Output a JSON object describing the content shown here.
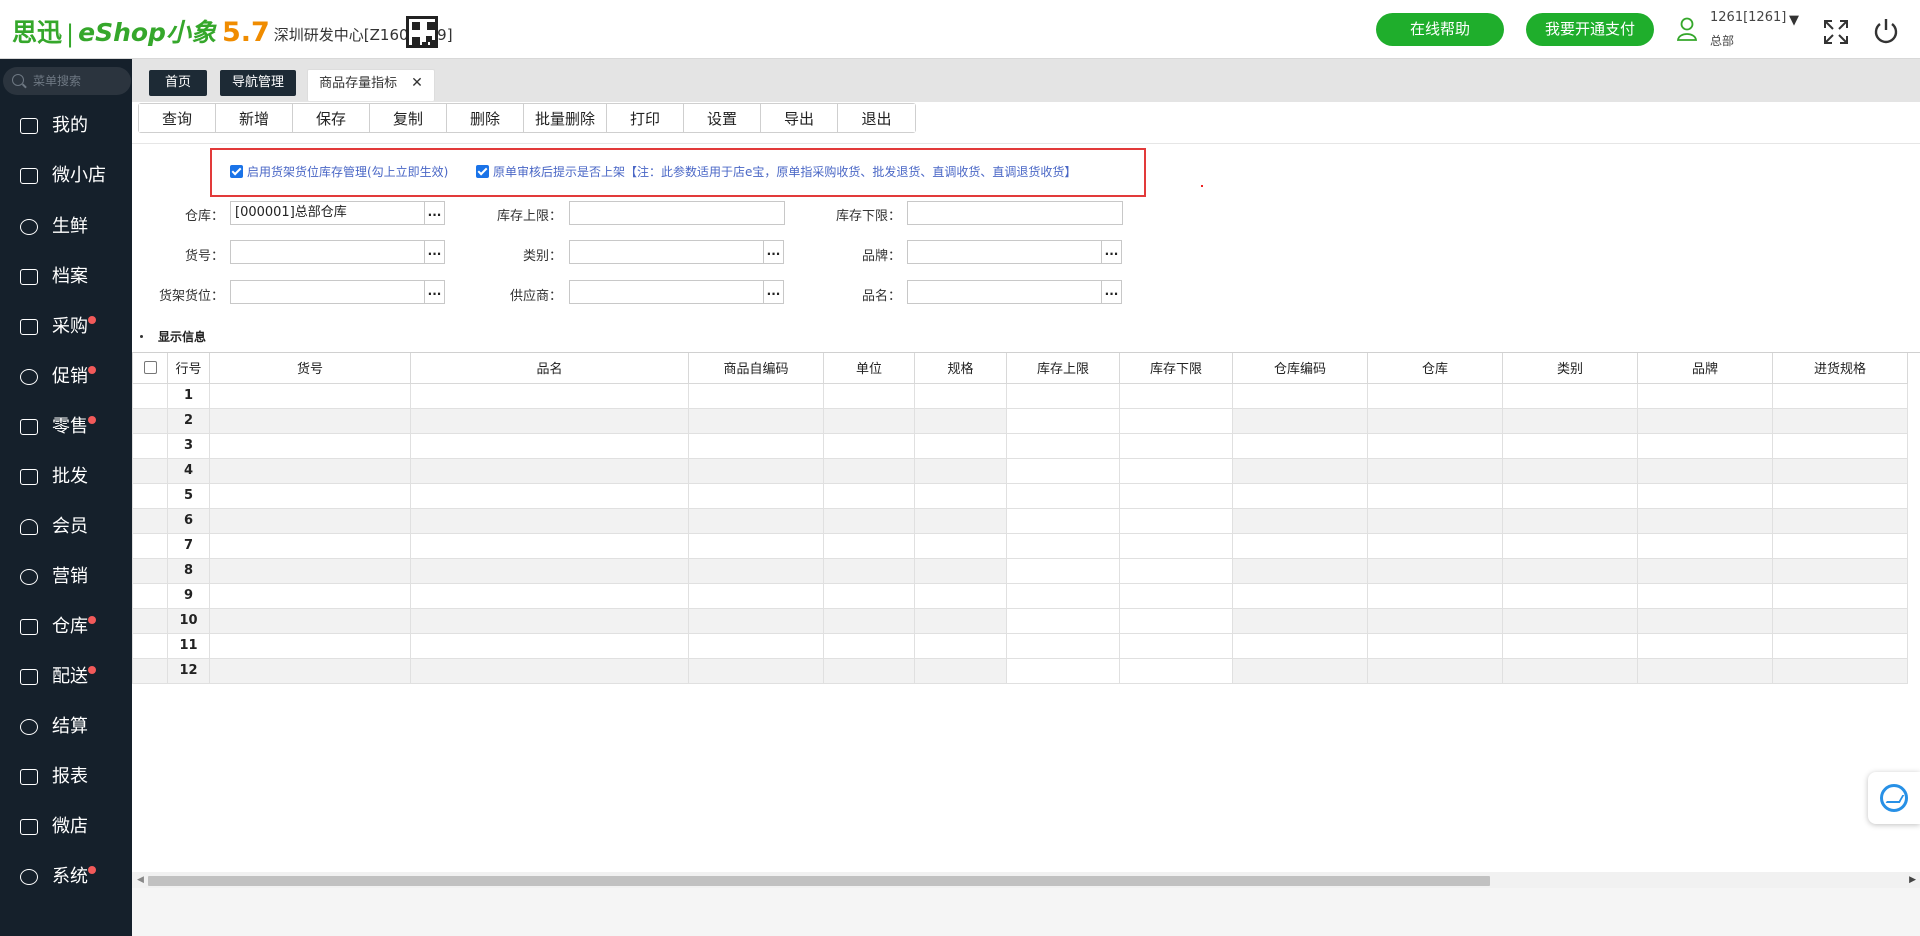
{
  "header": {
    "brand_cn": "思迅",
    "brand_sep": "|",
    "brand_name": "eShop小象",
    "version": "5.7",
    "org": "深圳研发中心[Z1600009]",
    "help_label": "在线帮助",
    "pay_label": "我要开通支付",
    "user_name": "1261[1261]",
    "user_role": "总部",
    "user_caret": "▼"
  },
  "sidebar": {
    "search_placeholder": "菜单搜索",
    "items": [
      {
        "label": "我的",
        "icon": "user-icon",
        "badge": false
      },
      {
        "label": "微小店",
        "icon": "shop-icon",
        "badge": false
      },
      {
        "label": "生鲜",
        "icon": "apple-icon",
        "badge": false
      },
      {
        "label": "档案",
        "icon": "file-icon",
        "badge": false
      },
      {
        "label": "采购",
        "icon": "basket-icon",
        "badge": true
      },
      {
        "label": "促销",
        "icon": "gear-icon",
        "badge": true
      },
      {
        "label": "零售",
        "icon": "bag-icon",
        "badge": true
      },
      {
        "label": "批发",
        "icon": "chart-icon",
        "badge": false
      },
      {
        "label": "会员",
        "icon": "member-icon",
        "badge": false
      },
      {
        "label": "营销",
        "icon": "marketing-icon",
        "badge": false
      },
      {
        "label": "仓库",
        "icon": "warehouse-icon",
        "badge": true
      },
      {
        "label": "配送",
        "icon": "truck-icon",
        "badge": true
      },
      {
        "label": "结算",
        "icon": "yen-icon",
        "badge": false
      },
      {
        "label": "报表",
        "icon": "report-icon",
        "badge": false
      },
      {
        "label": "微店",
        "icon": "store-icon",
        "badge": false
      },
      {
        "label": "系统",
        "icon": "settings-icon",
        "badge": true
      }
    ]
  },
  "tabs": [
    {
      "label": "首页"
    },
    {
      "label": "导航管理"
    },
    {
      "label": "商品存量指标",
      "close": "✕"
    }
  ],
  "toolbar": [
    "查询",
    "新增",
    "保存",
    "复制",
    "删除",
    "批量删除",
    "打印",
    "设置",
    "导出",
    "退出"
  ],
  "notice": {
    "option1": "启用货架货位库存管理(勾上立即生效)",
    "option2": "原单审核后提示是否上架【注：此参数适用于店e宝，原单指采购收货、批发退货、直调收货、直调退货收货】"
  },
  "form": {
    "warehouse_label": "仓库：",
    "warehouse_value": "[000001]总部仓库",
    "upper_label": "库存上限：",
    "lower_label": "库存下限：",
    "code_label": "货号：",
    "category_label": "类别：",
    "brand_label": "品牌：",
    "shelf_label": "货架货位：",
    "supplier_label": "供应商：",
    "name_label": "品名：",
    "more": "..."
  },
  "section_title": "显示信息",
  "table": {
    "columns": [
      "行号",
      "货号",
      "品名",
      "商品自编码",
      "单位",
      "规格",
      "库存上限",
      "库存下限",
      "仓库编码",
      "仓库",
      "类别",
      "品牌",
      "进货规格"
    ],
    "rows": [
      "1",
      "2",
      "3",
      "4",
      "5",
      "6",
      "7",
      "8",
      "9",
      "10",
      "11",
      "12"
    ]
  }
}
